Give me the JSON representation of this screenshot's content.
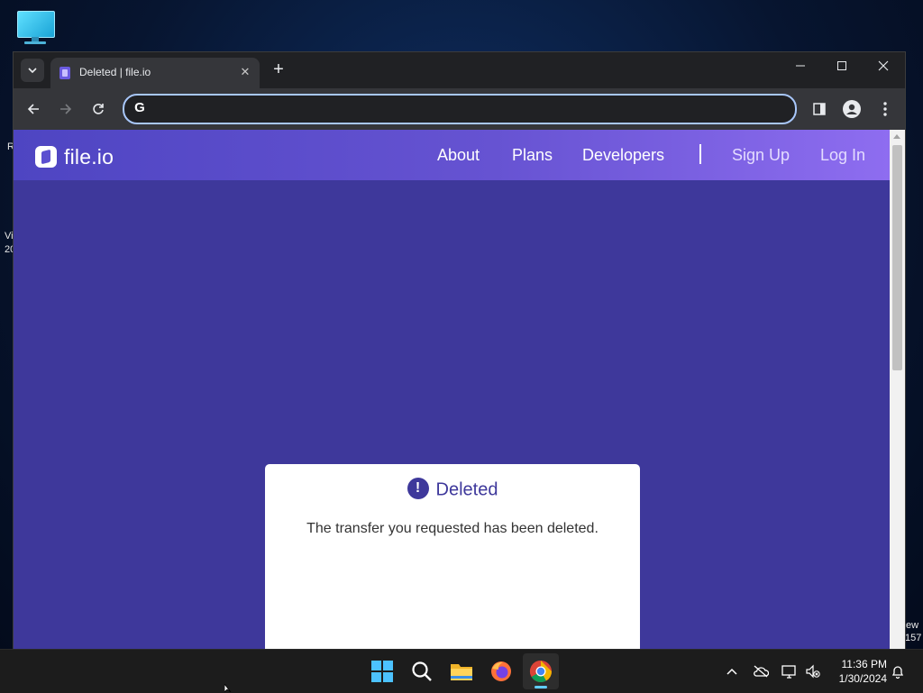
{
  "desktop": {
    "fragments": [
      "R",
      "Vi",
      "20",
      "ew",
      "157"
    ]
  },
  "browser": {
    "tab": {
      "title": "Deleted | file.io"
    },
    "omnibox": {
      "value": "",
      "placeholder": ""
    }
  },
  "site": {
    "logo_text": "file.io",
    "nav": {
      "about": "About",
      "plans": "Plans",
      "developers": "Developers",
      "sign_up": "Sign Up",
      "log_in": "Log In"
    },
    "colors": {
      "page_bg": "#3e389b",
      "header_start": "#4e45c2",
      "header_end": "#8e6df0"
    }
  },
  "card": {
    "icon_glyph": "!",
    "title": "Deleted",
    "message": "The transfer you requested has been deleted."
  },
  "taskbar": {
    "apps": [
      "windows-start",
      "search",
      "file-explorer",
      "firefox",
      "chrome"
    ],
    "clock": {
      "time": "11:36 PM",
      "date": "1/30/2024"
    }
  }
}
